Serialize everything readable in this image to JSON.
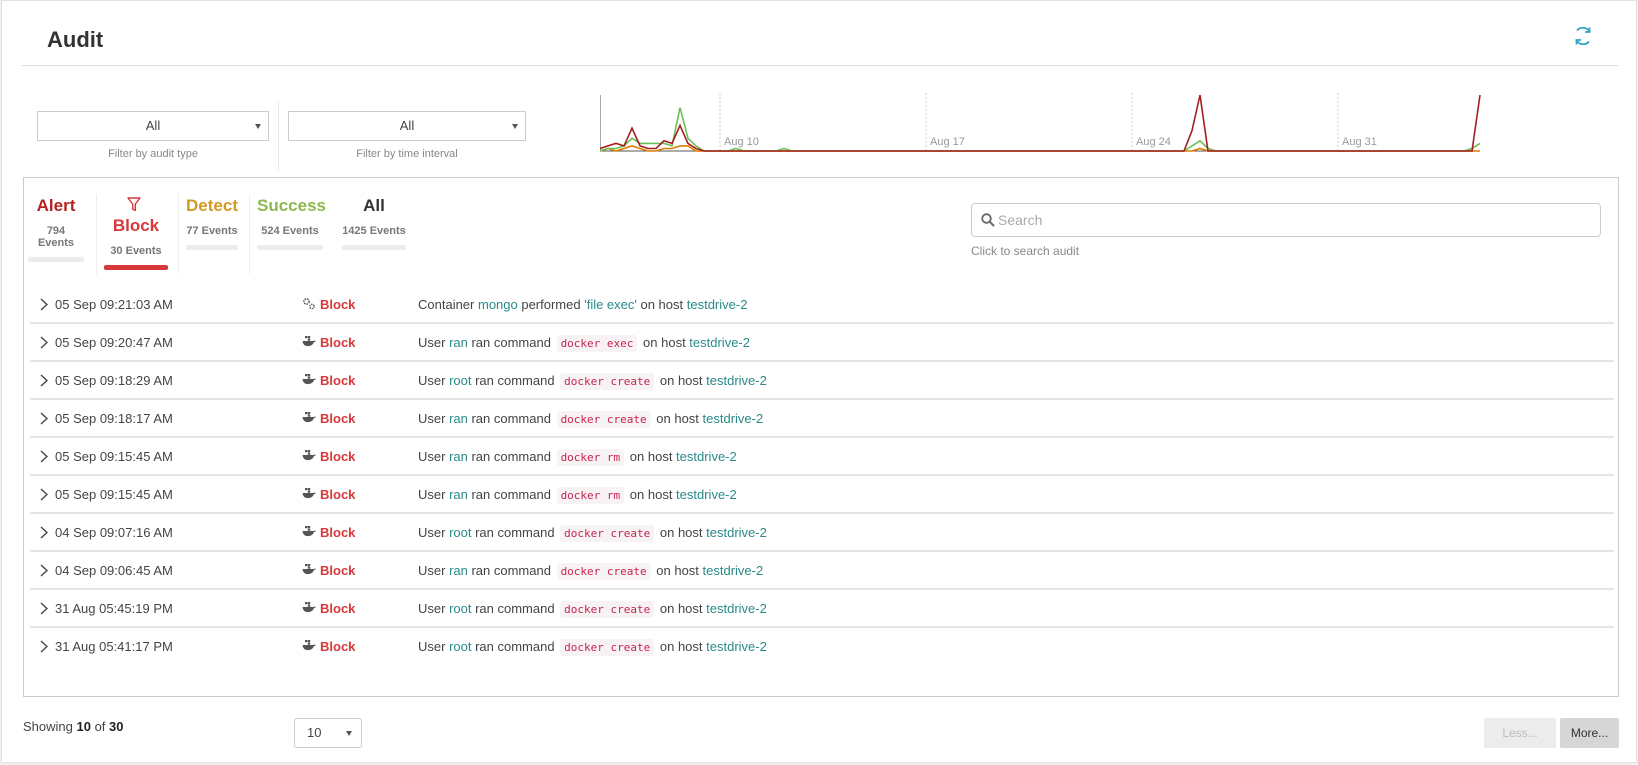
{
  "header": {
    "title": "Audit",
    "refresh_icon": "refresh-icon"
  },
  "filters": {
    "audit_type": {
      "value": "All",
      "hint": "Filter by audit type"
    },
    "time_interval": {
      "value": "All",
      "hint": "Filter by time interval"
    }
  },
  "chart_data": {
    "type": "line",
    "x_tick_labels": [
      "Aug 10",
      "Aug 17",
      "Aug 24",
      "Aug 31"
    ],
    "series": [
      {
        "color": "#a51f1f",
        "values": [
          1,
          2,
          3,
          2,
          9,
          2,
          1,
          1,
          4,
          3,
          10,
          3,
          1,
          0,
          0,
          0,
          0,
          0,
          0,
          0,
          0,
          0,
          0,
          0,
          0,
          0,
          0,
          0,
          0,
          0,
          0,
          0,
          0,
          0,
          0,
          0,
          0,
          0,
          0,
          0,
          0,
          0,
          0,
          0,
          0,
          0,
          0,
          0,
          0,
          0,
          0,
          0,
          0,
          0,
          0,
          0,
          0,
          0,
          0,
          0,
          0,
          0,
          0,
          0,
          0,
          0,
          0,
          0,
          0,
          0,
          0,
          0,
          0,
          0,
          8,
          22,
          0,
          0,
          0,
          0,
          0,
          0,
          0,
          0,
          0,
          0,
          0,
          0,
          0,
          0,
          0,
          0,
          0,
          0,
          0,
          0,
          0,
          0,
          0,
          0,
          0,
          0,
          0,
          0,
          0,
          0,
          0,
          0,
          0,
          0,
          22
        ]
      },
      {
        "color": "#6bbf59",
        "values": [
          0,
          1,
          1,
          2,
          5,
          3,
          3,
          3,
          3,
          2,
          17,
          5,
          2,
          0,
          0,
          0,
          0,
          1,
          0,
          0,
          0,
          0,
          0,
          1,
          0,
          0,
          0,
          0,
          0,
          0,
          0,
          0,
          0,
          0,
          0,
          0,
          0,
          0,
          0,
          0,
          0,
          0,
          0,
          0,
          0,
          0,
          0,
          0,
          0,
          0,
          0,
          0,
          0,
          0,
          0,
          0,
          0,
          0,
          0,
          0,
          0,
          0,
          0,
          0,
          0,
          0,
          0,
          0,
          0,
          0,
          0,
          0,
          0,
          0,
          2,
          4,
          1,
          0,
          0,
          0,
          0,
          0,
          0,
          0,
          0,
          0,
          0,
          0,
          0,
          0,
          0,
          0,
          0,
          0,
          0,
          0,
          0,
          0,
          0,
          0,
          0,
          0,
          0,
          0,
          0,
          0,
          0,
          0,
          0,
          1,
          3
        ]
      },
      {
        "color": "#e07b00",
        "values": [
          0,
          1,
          0,
          1,
          2,
          1,
          0,
          0,
          1,
          1,
          2,
          2,
          0,
          0,
          0,
          0,
          0,
          0,
          0,
          0,
          0,
          0,
          0,
          0,
          0,
          0,
          0,
          0,
          0,
          0,
          0,
          0,
          0,
          0,
          0,
          0,
          0,
          0,
          0,
          0,
          0,
          0,
          0,
          0,
          0,
          0,
          0,
          0,
          0,
          0,
          0,
          0,
          0,
          0,
          0,
          0,
          0,
          0,
          0,
          0,
          0,
          0,
          0,
          0,
          0,
          0,
          0,
          0,
          0,
          0,
          0,
          0,
          0,
          0,
          0,
          1,
          0,
          0,
          0,
          0,
          0,
          0,
          0,
          0,
          0,
          0,
          0,
          0,
          0,
          0,
          0,
          0,
          0,
          0,
          0,
          0,
          0,
          0,
          0,
          0,
          0,
          0,
          0,
          0,
          0,
          0,
          0,
          0,
          0,
          0,
          0
        ]
      }
    ]
  },
  "tabs": [
    {
      "label": "Alert",
      "count": "794 Events",
      "color": "#b22222"
    },
    {
      "label": "Block",
      "count": "30 Events",
      "color": "#d9383a"
    },
    {
      "label": "Detect",
      "count": "77 Events",
      "color": "#d19a22"
    },
    {
      "label": "Success",
      "count": "524 Events",
      "color": "#8cb84e"
    },
    {
      "label": "All",
      "count": "1425 Events",
      "color": "#333333"
    }
  ],
  "search": {
    "placeholder": "Search",
    "hint": "Click to search audit"
  },
  "rows": [
    {
      "time": "05 Sep 09:21:03 AM",
      "level": "Block",
      "icon": "gears-icon",
      "pre": "Container ",
      "subject": "mongo",
      "mid1": " performed ",
      "cmd": "'file exec'",
      "mid2": " on host ",
      "host": "testdrive-2"
    },
    {
      "time": "05 Sep 09:20:47 AM",
      "level": "Block",
      "icon": "docker-icon",
      "pre": "User ",
      "subject": "ran",
      "mid1": " ran command ",
      "cmd": "docker exec",
      "mid2": " on host ",
      "host": "testdrive-2"
    },
    {
      "time": "05 Sep 09:18:29 AM",
      "level": "Block",
      "icon": "docker-icon",
      "pre": "User ",
      "subject": "root",
      "mid1": " ran command ",
      "cmd": "docker create",
      "mid2": " on host ",
      "host": "testdrive-2"
    },
    {
      "time": "05 Sep 09:18:17 AM",
      "level": "Block",
      "icon": "docker-icon",
      "pre": "User ",
      "subject": "ran",
      "mid1": " ran command ",
      "cmd": "docker create",
      "mid2": " on host ",
      "host": "testdrive-2"
    },
    {
      "time": "05 Sep 09:15:45 AM",
      "level": "Block",
      "icon": "docker-icon",
      "pre": "User ",
      "subject": "ran",
      "mid1": " ran command ",
      "cmd": "docker rm",
      "mid2": " on host ",
      "host": "testdrive-2"
    },
    {
      "time": "05 Sep 09:15:45 AM",
      "level": "Block",
      "icon": "docker-icon",
      "pre": "User ",
      "subject": "ran",
      "mid1": " ran command ",
      "cmd": "docker rm",
      "mid2": " on host ",
      "host": "testdrive-2"
    },
    {
      "time": "04 Sep 09:07:16 AM",
      "level": "Block",
      "icon": "docker-icon",
      "pre": "User ",
      "subject": "root",
      "mid1": " ran command ",
      "cmd": "docker create",
      "mid2": " on host ",
      "host": "testdrive-2"
    },
    {
      "time": "04 Sep 09:06:45 AM",
      "level": "Block",
      "icon": "docker-icon",
      "pre": "User ",
      "subject": "ran",
      "mid1": " ran command ",
      "cmd": "docker create",
      "mid2": " on host ",
      "host": "testdrive-2"
    },
    {
      "time": "31 Aug 05:45:19 PM",
      "level": "Block",
      "icon": "docker-icon",
      "pre": "User ",
      "subject": "root",
      "mid1": " ran command ",
      "cmd": "docker create",
      "mid2": " on host ",
      "host": "testdrive-2"
    },
    {
      "time": "31 Aug 05:41:17 PM",
      "level": "Block",
      "icon": "docker-icon",
      "pre": "User ",
      "subject": "root",
      "mid1": " ran command ",
      "cmd": "docker create",
      "mid2": " on host ",
      "host": "testdrive-2"
    }
  ],
  "footer": {
    "showing_prefix": "Showing ",
    "shown": "10",
    "of_word": " of ",
    "total": "30",
    "page_size": "10",
    "less_label": "Less...",
    "more_label": "More..."
  }
}
